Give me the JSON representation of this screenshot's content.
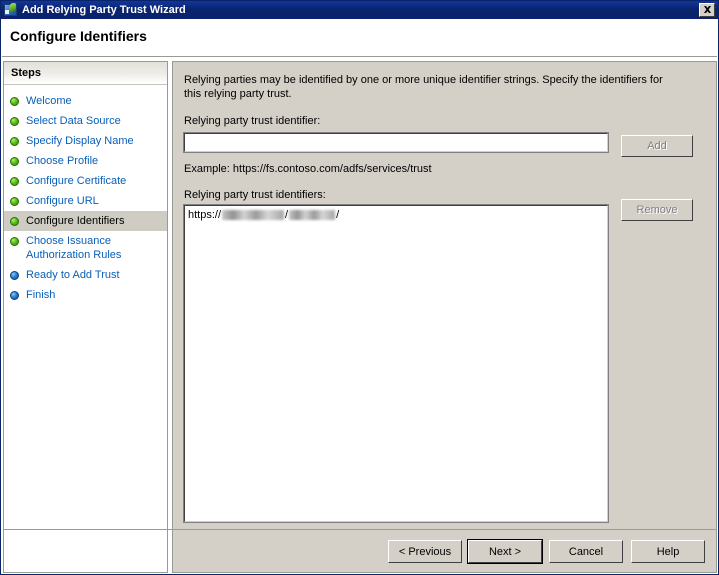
{
  "window": {
    "title": "Add Relying Party Trust Wizard",
    "icon": "adfs-wizard-icon",
    "close_label": "Close",
    "page_title": "Configure Identifiers"
  },
  "sidebar": {
    "header": "Steps",
    "items": [
      {
        "label": "Welcome",
        "state": "completed",
        "bullet": "green"
      },
      {
        "label": "Select Data Source",
        "state": "completed",
        "bullet": "green"
      },
      {
        "label": "Specify Display Name",
        "state": "completed",
        "bullet": "green"
      },
      {
        "label": "Choose Profile",
        "state": "completed",
        "bullet": "green"
      },
      {
        "label": "Configure Certificate",
        "state": "completed",
        "bullet": "green"
      },
      {
        "label": "Configure URL",
        "state": "completed",
        "bullet": "green"
      },
      {
        "label": "Configure Identifiers",
        "state": "current",
        "bullet": "green"
      },
      {
        "label": "Choose Issuance\nAuthorization Rules",
        "state": "completed",
        "bullet": "green"
      },
      {
        "label": "Ready to Add Trust",
        "state": "pending",
        "bullet": "blue"
      },
      {
        "label": "Finish",
        "state": "pending",
        "bullet": "blue"
      }
    ]
  },
  "content": {
    "intro": "Relying parties may be identified by one or more unique identifier strings. Specify the identifiers for this relying party trust.",
    "identifier_label": "Relying party trust identifier:",
    "identifier_value": "",
    "identifier_placeholder": "",
    "example": "Example: https://fs.contoso.com/adfs/services/trust",
    "identifiers_label": "Relying party trust identifiers:",
    "identifiers": [
      {
        "prefix": "https://",
        "redacted_host": true,
        "separator1": "/",
        "redacted_path": true,
        "suffix": "/"
      }
    ],
    "add_label": "Add",
    "add_enabled": false,
    "remove_label": "Remove",
    "remove_enabled": false
  },
  "footer": {
    "previous_label": "< Previous",
    "next_label": "Next >",
    "cancel_label": "Cancel",
    "help_label": "Help",
    "default_button": "next"
  },
  "colors": {
    "titlebar": "#0a246a",
    "dialog_face": "#d4d0c8",
    "link": "#0a5fb8",
    "selected_step": "#cfccc4",
    "bullet_green": "#5fc31e",
    "bullet_blue": "#2a7fd4"
  }
}
